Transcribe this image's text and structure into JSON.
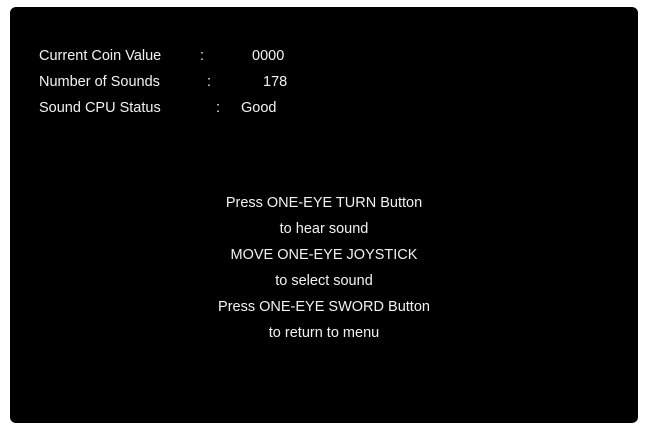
{
  "status": {
    "coin_label": "Current Coin Value",
    "coin_value": "0000",
    "sounds_label": "Number of Sounds",
    "sounds_value": "178",
    "cpu_label": "Sound CPU Status",
    "cpu_value": "Good",
    "separator": ":"
  },
  "instructions": [
    "Press ONE-EYE TURN Button",
    "to hear sound",
    "MOVE ONE-EYE JOYSTICK",
    "to select sound",
    "Press ONE-EYE SWORD Button",
    "to return to menu"
  ],
  "colors": {
    "screen_bg": "#000000",
    "text": "#f2f2f2",
    "page_bg": "#ffffff"
  }
}
